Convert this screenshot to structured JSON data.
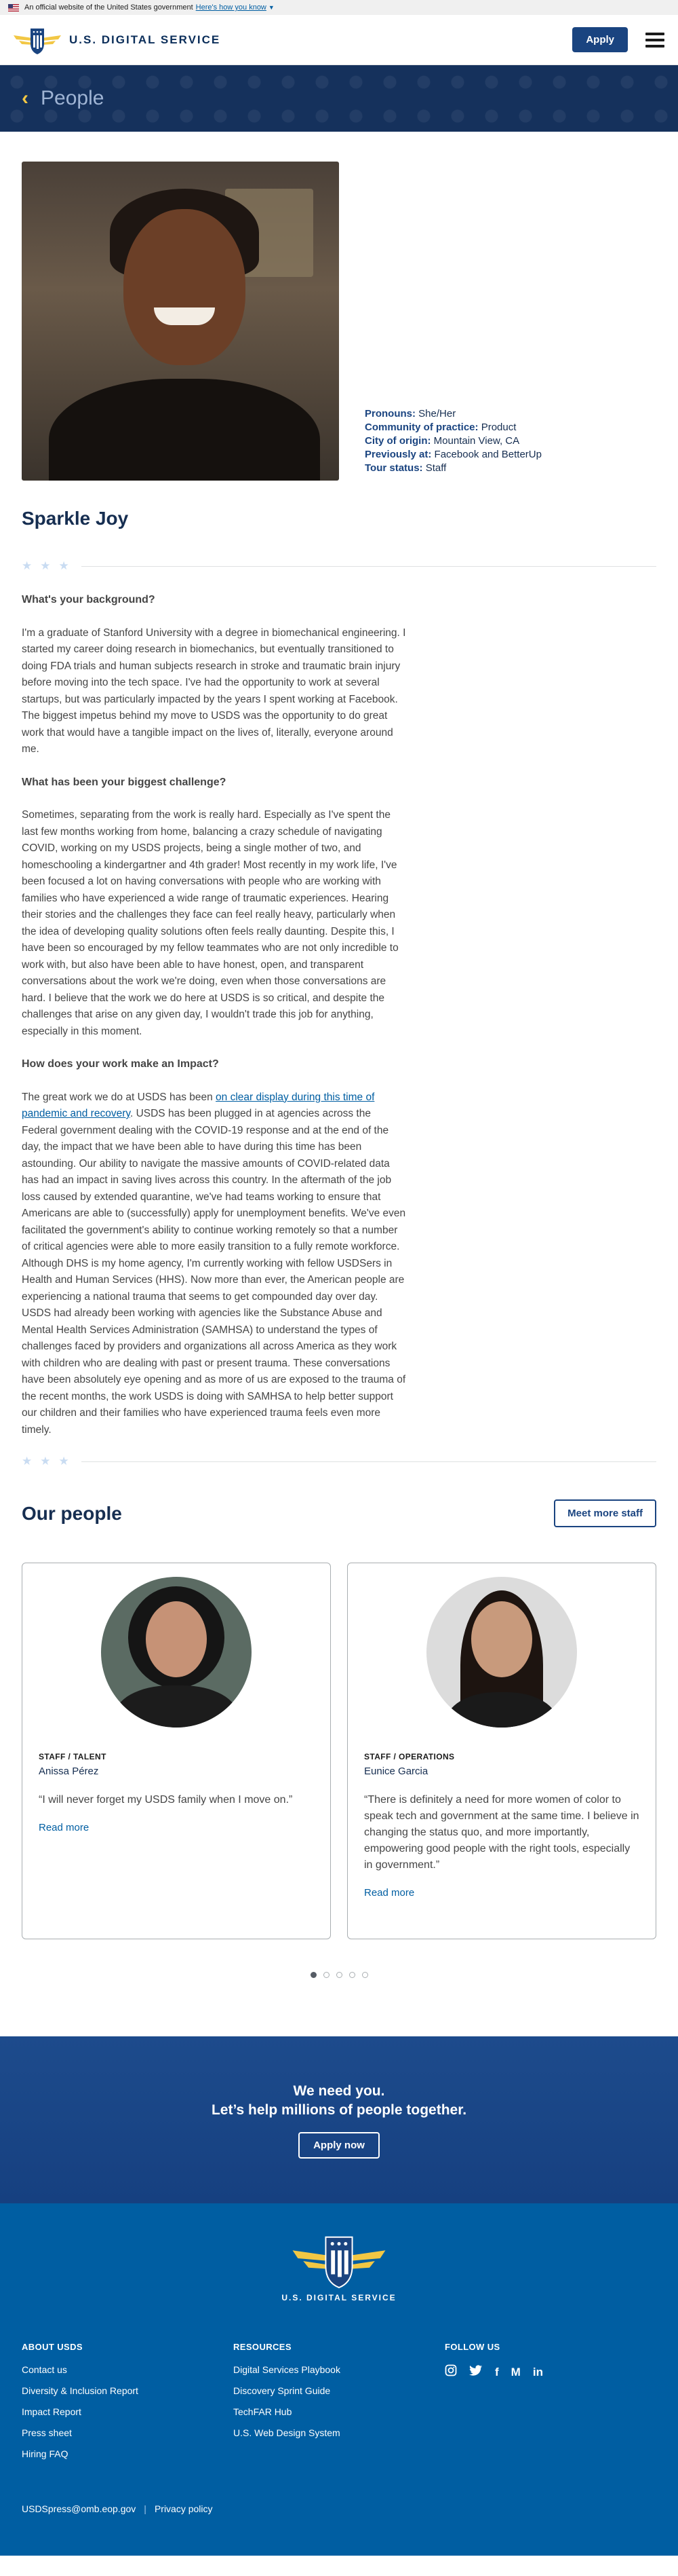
{
  "gov_banner": {
    "text": "An official website of the United States government",
    "link": "Here's how you know"
  },
  "header": {
    "logo_text": "U.S. DIGITAL SERVICE",
    "apply_label": "Apply"
  },
  "hero": {
    "title": "People"
  },
  "profile": {
    "pronouns_label": "Pronouns:",
    "pronouns": "She/Her",
    "community_label": "Community of practice:",
    "community": "Product",
    "city_label": "City of origin:",
    "city": "Mountain View, CA",
    "previously_label": "Previously at:",
    "previously": "Facebook and BetterUp",
    "tour_label": "Tour status:",
    "tour": "Staff",
    "name": "Sparkle Joy"
  },
  "article": {
    "q1": "What's your background?",
    "a1": "I'm a graduate of Stanford University with a degree in biomechanical engineering. I started my career doing research in biomechanics, but eventually transitioned to doing FDA trials and human subjects research in stroke and traumatic brain injury before moving into the tech space. I've had the opportunity to work at several startups, but was particularly impacted by the years I spent working at Facebook. The biggest impetus behind my move to USDS was the opportunity to do great work that would have a tangible impact on the lives of, literally, everyone around me.",
    "q2": "What has been your biggest challenge?",
    "a2": "Sometimes, separating from the work is really hard. Especially as I've spent the last few months working from home, balancing a crazy schedule of navigating COVID, working on my USDS projects, being a single mother of two, and homeschooling a kindergartner and 4th grader! Most recently in my work life, I've been focused a lot on having conversations with people who are working with families who have experienced a wide range of traumatic experiences. Hearing their stories and the challenges they face can feel really heavy, particularly when the idea of developing quality solutions often feels really daunting. Despite this, I have been so encouraged by my fellow teammates who are not only incredible to work with, but also have been able to have honest, open, and transparent conversations about the work we're doing, even when those conversations are hard. I believe that the work we do here at USDS is so critical, and despite the challenges that arise on any given day, I wouldn't trade this job for anything, especially in this moment.",
    "q3": "How does your work make an Impact?",
    "a3_pre": "The great work we do at USDS has been ",
    "a3_link": "on clear display during this time of pandemic and recovery",
    "a3_post": ". USDS has been plugged in at agencies across the Federal government dealing with the COVID-19 response and at the end of the day, the impact that we have been able to have during this time has been astounding. Our ability to navigate the massive amounts of COVID-related data has had an impact in saving lives across this country. In the aftermath of the job loss caused by extended quarantine, we've had teams working to ensure that Americans are able to (successfully) apply for unemployment benefits. We've even facilitated the government's ability to continue working remotely so that a number of critical agencies were able to more easily transition to a fully remote workforce. Although DHS is my home agency, I'm currently working with fellow USDSers in Health and Human Services (HHS). Now more than ever, the American people are experiencing a national trauma that seems to get compounded day over day. USDS had already been working with agencies like the Substance Abuse and Mental Health Services Administration (SAMHSA) to understand the types of challenges faced by providers and organizations all across America as they work with children who are dealing with past or present trauma. These conversations have been absolutely eye opening and as more of us are exposed to the trauma of the recent months, the work USDS is doing with SAMHSA to help better support our children and their families who have experienced trauma feels even more timely."
  },
  "our_people": {
    "title": "Our people",
    "more_label": "Meet more staff",
    "cards": [
      {
        "role": "STAFF / TALENT",
        "name": "Anissa Pérez",
        "quote": "“I will never forget my USDS family when I move on.”",
        "link": "Read more"
      },
      {
        "role": "STAFF / OPERATIONS",
        "name": "Eunice Garcia",
        "quote": "“There is definitely a need for more women of color to speak tech and government at the same time. I believe in changing the status quo, and more importantly, empowering good people with the right tools, especially in government.”",
        "link": "Read more"
      }
    ]
  },
  "cta": {
    "line1": "We need you.",
    "line2": "Let’s help millions of people together.",
    "button": "Apply now"
  },
  "footer": {
    "logo_text": "U.S. DIGITAL SERVICE",
    "about_title": "ABOUT USDS",
    "about_links": [
      "Contact us",
      "Diversity & Inclusion Report",
      "Impact Report",
      "Press sheet",
      "Hiring FAQ"
    ],
    "resources_title": "RESOURCES",
    "resources_links": [
      "Digital Services Playbook",
      "Discovery Sprint Guide",
      "TechFAR Hub",
      "U.S. Web Design System"
    ],
    "follow_title": "FOLLOW US",
    "social": [
      "instagram-icon",
      "twitter-icon",
      "facebook-icon",
      "medium-icon",
      "linkedin-icon"
    ],
    "email": "USDSpress@omb.eop.gov",
    "privacy": "Privacy policy"
  }
}
